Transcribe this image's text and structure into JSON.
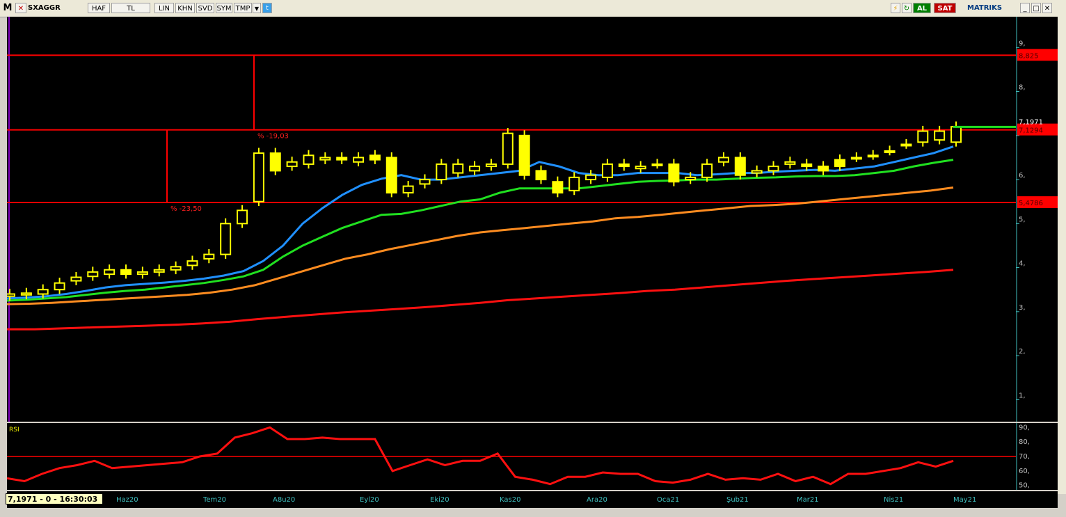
{
  "toolbar": {
    "logo": "M",
    "symbol": "SXAGGR",
    "buttons": [
      "HAF",
      "TL",
      "LIN",
      "KHN",
      "SVD",
      "SYM",
      "TMP"
    ],
    "buy_label": "AL",
    "sell_label": "SAT",
    "brand": "MATRIKS"
  },
  "price_labels": {
    "line_top": "8,825",
    "last": "7,1971",
    "line_mid": "7,1294",
    "line_low": "5,4786"
  },
  "annotations": {
    "pct1": "% -19,03",
    "pct2": "% -23,50"
  },
  "y_ticks": [
    "9,",
    "8,",
    "7,",
    "6,",
    "5,",
    "4,",
    "3,",
    "2,",
    "1,"
  ],
  "rsi": {
    "label": "RSI",
    "ticks": [
      "90,",
      "80,",
      "70,",
      "60,",
      "50,"
    ]
  },
  "x_labels": [
    "Haz20",
    "Tem20",
    "A8u20",
    "Eyl20",
    "Eki20",
    "Kas20",
    "Ara20",
    "Oca21",
    "Şub21",
    "Mar21",
    "Nis21",
    "May21"
  ],
  "readout": "7,1971 - 0 - 16:30:03",
  "chart_data": {
    "type": "candlestick",
    "ylim": [
      0.5,
      9.7
    ],
    "horizontal_lines": [
      8.825,
      7.1294,
      5.4786
    ],
    "close": [
      3.4,
      3.42,
      3.5,
      3.65,
      3.78,
      3.9,
      3.95,
      3.85,
      3.9,
      3.95,
      4.02,
      4.15,
      4.3,
      5.0,
      5.3,
      6.6,
      6.2,
      6.4,
      6.55,
      6.5,
      6.45,
      6.5,
      6.45,
      5.7,
      5.85,
      6.0,
      6.35,
      6.35,
      6.3,
      6.35,
      7.05,
      6.1,
      6.0,
      5.7,
      6.05,
      6.1,
      6.35,
      6.3,
      6.3,
      6.35,
      5.95,
      6.05,
      6.35,
      6.5,
      6.1,
      6.2,
      6.3,
      6.4,
      6.3,
      6.2,
      6.3,
      6.5,
      6.55,
      6.65,
      6.8,
      7.1,
      7.1,
      7.2
    ],
    "open": [
      3.35,
      3.38,
      3.4,
      3.5,
      3.7,
      3.8,
      3.85,
      3.95,
      3.85,
      3.9,
      3.95,
      4.05,
      4.2,
      4.3,
      5.0,
      5.5,
      6.6,
      6.3,
      6.35,
      6.45,
      6.5,
      6.4,
      6.55,
      6.5,
      5.7,
      5.9,
      6.0,
      6.15,
      6.2,
      6.3,
      6.35,
      7.0,
      6.2,
      5.95,
      5.75,
      6.0,
      6.05,
      6.35,
      6.25,
      6.35,
      6.35,
      6.0,
      6.05,
      6.4,
      6.5,
      6.15,
      6.2,
      6.35,
      6.35,
      6.3,
      6.45,
      6.5,
      6.55,
      6.65,
      6.8,
      6.85,
      6.9,
      6.85
    ],
    "ma_blue": [
      3.3,
      3.32,
      3.35,
      3.4,
      3.47,
      3.55,
      3.6,
      3.63,
      3.66,
      3.7,
      3.75,
      3.82,
      3.92,
      4.15,
      4.5,
      5.0,
      5.35,
      5.65,
      5.88,
      6.02,
      6.1,
      6.0,
      6.0,
      6.05,
      6.1,
      6.15,
      6.2,
      6.4,
      6.3,
      6.15,
      6.1,
      6.1,
      6.15,
      6.15,
      6.15,
      6.1,
      6.12,
      6.15,
      6.15,
      6.18,
      6.2,
      6.22,
      6.2,
      6.25,
      6.3,
      6.4,
      6.5,
      6.6,
      6.75
    ],
    "ma_green": [
      3.25,
      3.27,
      3.3,
      3.33,
      3.38,
      3.43,
      3.47,
      3.5,
      3.55,
      3.6,
      3.65,
      3.72,
      3.8,
      3.95,
      4.25,
      4.5,
      4.7,
      4.9,
      5.05,
      5.2,
      5.22,
      5.3,
      5.4,
      5.5,
      5.55,
      5.7,
      5.8,
      5.8,
      5.8,
      5.8,
      5.85,
      5.9,
      5.95,
      5.97,
      5.98,
      6.0,
      6.0,
      6.02,
      6.04,
      6.05,
      6.07,
      6.08,
      6.08,
      6.1,
      6.15,
      6.2,
      6.3,
      6.38,
      6.45
    ],
    "ma_orange": [
      3.17,
      3.18,
      3.2,
      3.23,
      3.26,
      3.29,
      3.32,
      3.35,
      3.38,
      3.43,
      3.5,
      3.6,
      3.75,
      3.9,
      4.05,
      4.2,
      4.3,
      4.42,
      4.52,
      4.62,
      4.72,
      4.8,
      4.85,
      4.9,
      4.95,
      5.0,
      5.05,
      5.12,
      5.15,
      5.2,
      5.25,
      5.3,
      5.35,
      5.4,
      5.42,
      5.45,
      5.5,
      5.55,
      5.6,
      5.65,
      5.7,
      5.75,
      5.82
    ],
    "ma_red": [
      2.6,
      2.6,
      2.62,
      2.64,
      2.66,
      2.68,
      2.7,
      2.73,
      2.77,
      2.83,
      2.88,
      2.93,
      2.98,
      3.02,
      3.06,
      3.1,
      3.15,
      3.2,
      3.26,
      3.3,
      3.34,
      3.38,
      3.42,
      3.47,
      3.5,
      3.55,
      3.6,
      3.65,
      3.7,
      3.74,
      3.78,
      3.82,
      3.86,
      3.9,
      3.95
    ],
    "rsi_values": [
      55,
      53,
      58,
      62,
      64,
      67,
      62,
      63,
      64,
      65,
      66,
      70,
      72,
      83,
      86,
      90,
      82,
      82,
      83,
      82,
      82,
      82,
      60,
      64,
      68,
      64,
      67,
      67,
      72,
      56,
      54,
      51,
      56,
      56,
      59,
      58,
      58,
      53,
      52,
      54,
      58,
      54,
      55,
      54,
      58,
      53,
      56,
      51,
      58,
      58,
      60,
      62,
      66,
      63,
      67
    ]
  }
}
